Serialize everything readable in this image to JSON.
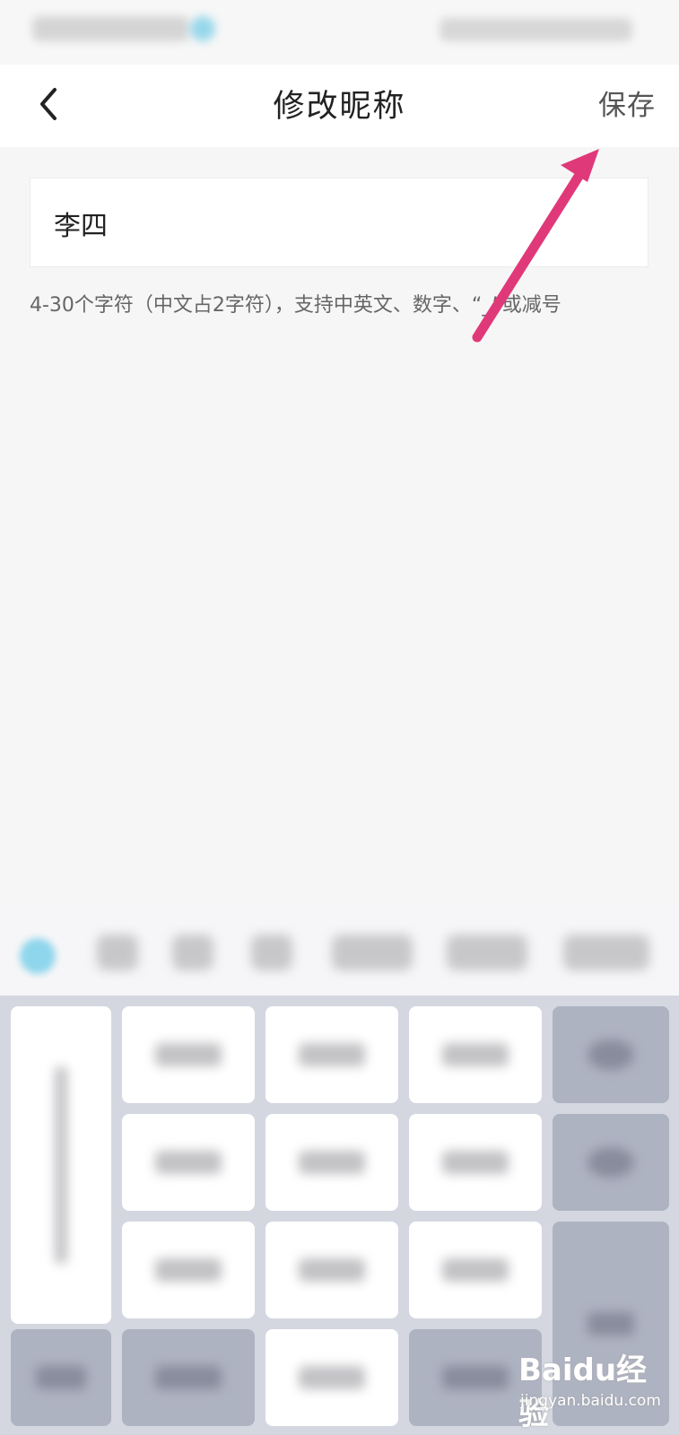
{
  "header": {
    "title": "修改昵称",
    "save_label": "保存"
  },
  "nickname": {
    "value": "李四"
  },
  "hint": "4-30个字符（中文占2字符），支持中英文、数字、“_”或减号",
  "watermark": {
    "logo": "Baidu经验",
    "sub": "jingyan.baidu.com"
  },
  "colors": {
    "header_bg": "#ffffff",
    "page_bg": "#f6f6f6",
    "annotation_arrow": "#e0397a"
  },
  "icons": {
    "back": "chevron-left-icon",
    "annotation": "arrow-icon"
  }
}
